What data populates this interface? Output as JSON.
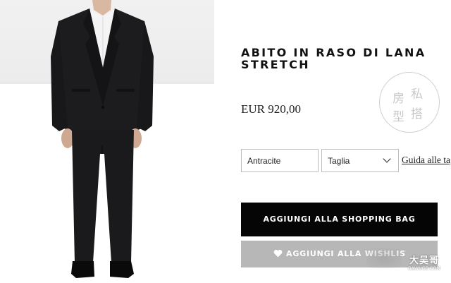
{
  "product": {
    "title": "ABITO IN RASO DI LANA STRETCH",
    "price": "EUR 920,00",
    "image_alt": "suit-model-image"
  },
  "options": {
    "color_value": "Antracite",
    "size_value": "Taglia",
    "size_guide_label": "Guida alle taglie"
  },
  "actions": {
    "add_to_bag_label": "AGGIUNGI ALLA SHOPPING BAG",
    "add_to_wishlist_label": "AGGIUNGI ALLA WISHLIST"
  },
  "stamp": {
    "chars": [
      "私",
      "房",
      "搭",
      "型"
    ]
  },
  "watermark": {
    "main": "大吴哥",
    "sub": "DAWUGE.COM"
  },
  "colors": {
    "primary_button": "#050505",
    "secondary_button": "#b7b7b7",
    "suit": "#1b1b1d"
  }
}
